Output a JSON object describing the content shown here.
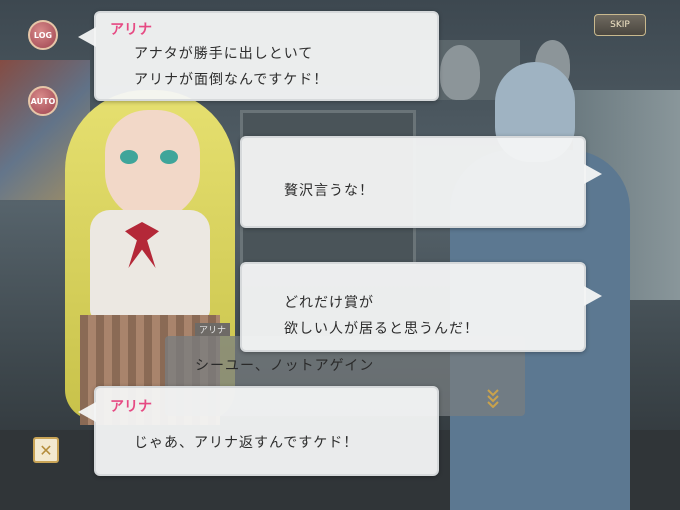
{
  "controls": {
    "log_label": "LOG",
    "auto_label": "AUTO",
    "skip_label": "SKIP",
    "close_glyph": "✕"
  },
  "dialogue": [
    {
      "speaker": "アリナ",
      "lines": [
        "アナタが勝手に出しといて",
        "アリナが面倒なんですケド！"
      ]
    },
    {
      "speaker": "",
      "lines": [
        "贅沢言うな！"
      ]
    },
    {
      "speaker": "",
      "lines": [
        "どれだけ賞が",
        "欲しい人が居ると思うんだ！"
      ]
    },
    {
      "speaker": "アリナ",
      "lines": [
        "じゃあ、アリナ返すんですケド！"
      ]
    }
  ],
  "background_dialogue": {
    "speaker": "アリナ",
    "line": "シーユー、ノットアゲイン"
  },
  "colors": {
    "speaker_name": "#e64a83",
    "bubble_bg": "#f4f5f6",
    "button_gold": "#c9a456"
  },
  "icons": [
    "log-icon",
    "auto-icon",
    "skip-icon",
    "close-icon",
    "advance-arrow-icon"
  ]
}
